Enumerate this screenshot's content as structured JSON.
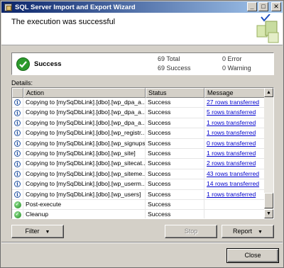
{
  "window": {
    "title": "SQL Server Import and Export Wizard"
  },
  "title_buttons": {
    "minimize": "_",
    "maximize": "□",
    "close": "✕"
  },
  "header": {
    "heading": "The execution was successful"
  },
  "summary": {
    "status": "Success",
    "total": "69 Total",
    "success": "69 Success",
    "error": "0 Error",
    "warning": "0 Warning"
  },
  "details": {
    "label": "Details:",
    "columns": [
      "Action",
      "Status",
      "Message"
    ],
    "rows": [
      {
        "icon": "info-icon",
        "action": "Copying to [mySqDbLink].[dbo].[wp_dpa_a...",
        "status": "Success",
        "message": "27 rows transferred"
      },
      {
        "icon": "info-icon",
        "action": "Copying to [mySqDbLink].[dbo].[wp_dpa_a...",
        "status": "Success",
        "message": "5 rows transferred"
      },
      {
        "icon": "info-icon",
        "action": "Copying to [mySqDbLink].[dbo].[wp_dpa_a...",
        "status": "Success",
        "message": "1 rows transferred"
      },
      {
        "icon": "info-icon",
        "action": "Copying to [mySqDbLink].[dbo].[wp_registr...",
        "status": "Success",
        "message": "1 rows transferred"
      },
      {
        "icon": "info-icon",
        "action": "Copying to [mySqDbLink].[dbo].[wp_signups]",
        "status": "Success",
        "message": "0 rows transferred"
      },
      {
        "icon": "info-icon",
        "action": "Copying to [mySqDbLink].[dbo].[wp_site]",
        "status": "Success",
        "message": "1 rows transferred"
      },
      {
        "icon": "info-icon",
        "action": "Copying to [mySqDbLink].[dbo].[wp_sitecat...",
        "status": "Success",
        "message": "2 rows transferred"
      },
      {
        "icon": "info-icon",
        "action": "Copying to [mySqDbLink].[dbo].[wp_siteme...",
        "status": "Success",
        "message": "43 rows transferred"
      },
      {
        "icon": "info-icon",
        "action": "Copying to [mySqDbLink].[dbo].[wp_userm...",
        "status": "Success",
        "message": "14 rows transferred"
      },
      {
        "icon": "info-icon",
        "action": "Copying to [mySqDbLink].[dbo].[wp_users]",
        "status": "Success",
        "message": "1 rows transferred"
      },
      {
        "icon": "check-icon",
        "action": "Post-execute",
        "status": "Success",
        "message": ""
      },
      {
        "icon": "check-icon",
        "action": "Cleanup",
        "status": "Success",
        "message": ""
      }
    ]
  },
  "buttons": {
    "filter": "Filter",
    "stop": "Stop",
    "report": "Report",
    "close": "Close"
  }
}
